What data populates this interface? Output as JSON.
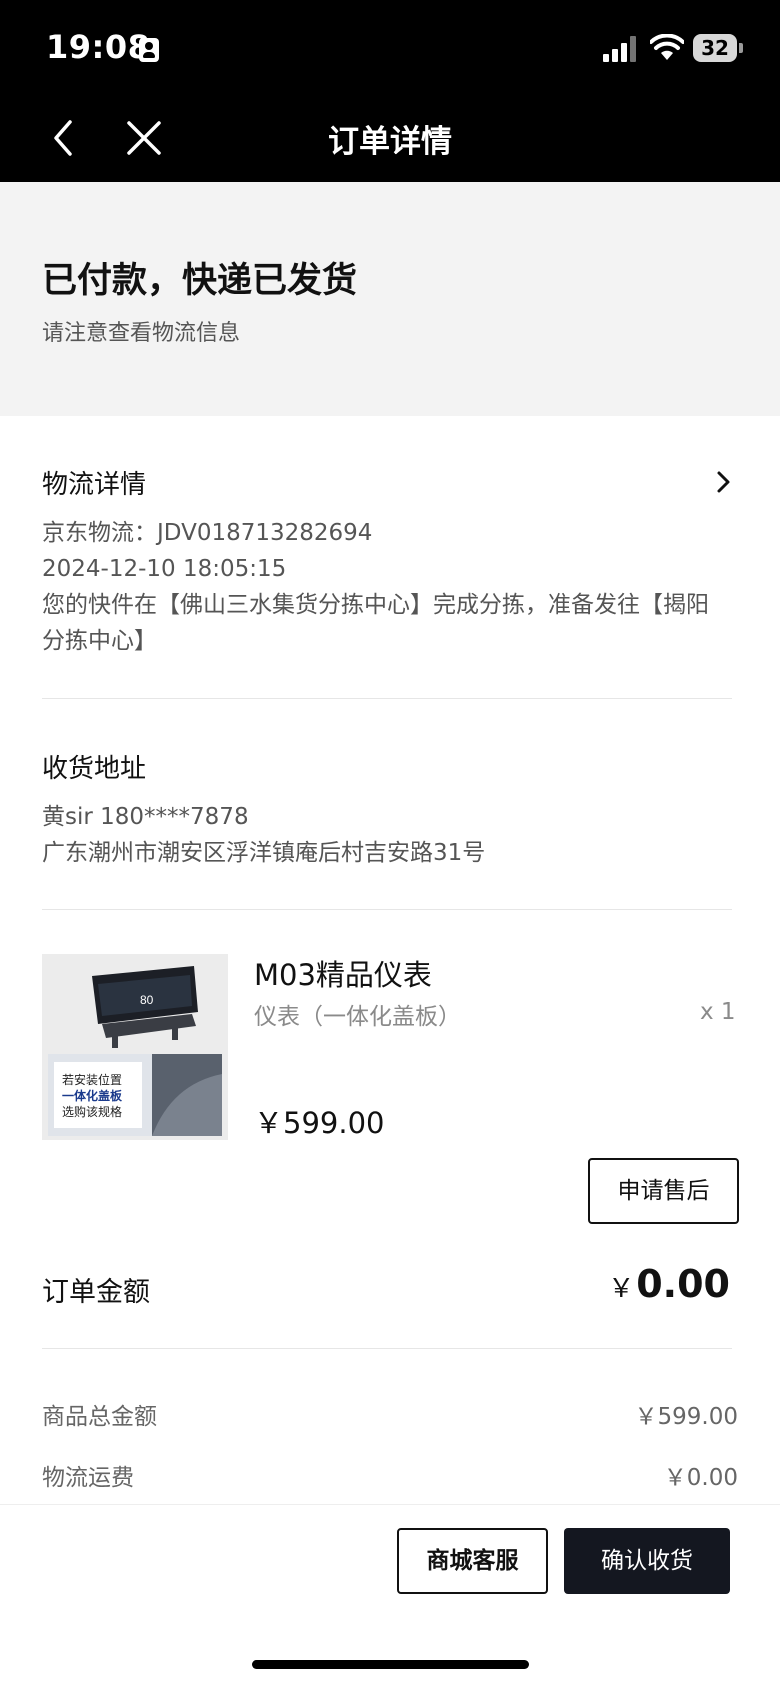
{
  "status_bar": {
    "time": "19:08",
    "battery": "32"
  },
  "nav": {
    "title": "订单详情"
  },
  "banner": {
    "title": "已付款，快递已发货",
    "subtitle": "请注意查看物流信息"
  },
  "logistics": {
    "title": "物流详情",
    "tracking": "京东物流：JDV018713282694",
    "time": "2024-12-10 18:05:15",
    "message_line1": "您的快件在【佛山三水集货分拣中心】完成分拣，准备发往【揭阳",
    "message_line2": "分拣中心】"
  },
  "address": {
    "title": "收货地址",
    "contact": "黄sir  180****7878",
    "detail": "广东潮州市潮安区浮洋镇庵后村吉安路31号"
  },
  "product": {
    "name": "M03精品仪表",
    "spec": "仪表（一体化盖板）",
    "qty": "x 1",
    "price": "￥599.00",
    "image_screen_value": "80",
    "image_caption_1": "若安装位置",
    "image_caption_2": "一体化盖板",
    "image_caption_3": "选购该规格",
    "aftersale_label": "申请售后"
  },
  "order": {
    "total_label": "订单金额",
    "total_currency": "￥",
    "total_value": "0.00",
    "goods_total_label": "商品总金额",
    "goods_total_value": "￥599.00",
    "shipping_label": "物流运费",
    "shipping_value": "￥0.00"
  },
  "actions": {
    "service_label": "商城客服",
    "confirm_label": "确认收货"
  },
  "colors": {
    "nav_bg": "#000000",
    "banner_bg": "#f3f3f3",
    "primary_button": "#141720"
  }
}
